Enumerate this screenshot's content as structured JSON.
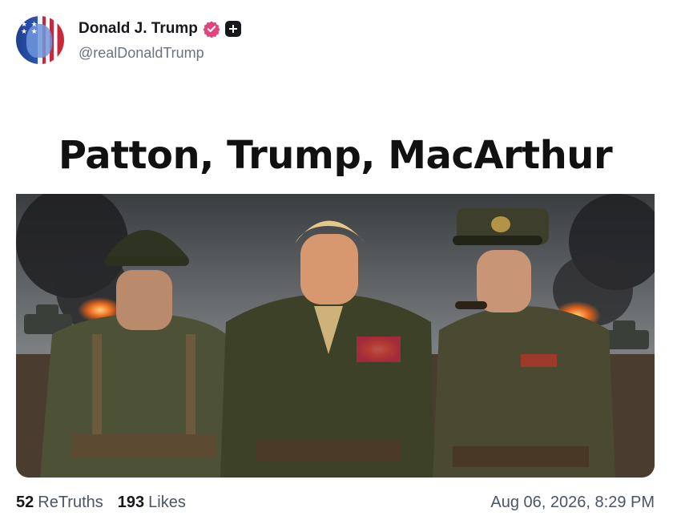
{
  "post": {
    "author": {
      "display_name": "Donald J. Trump",
      "handle": "@realDonaldTrump",
      "avatar_icon": "avatar-flag-portrait",
      "verified_icon": "verified-badge-icon",
      "plus_icon": "plus-square-icon"
    },
    "media": {
      "headline": "Patton, Trump, MacArthur",
      "image_description_icon": "military-portrait-image"
    },
    "stats": {
      "retruths_count": "52",
      "retruths_label": "ReTruths",
      "likes_count": "193",
      "likes_label": "Likes"
    },
    "timestamp": "Aug 06, 2026, 8:29 PM"
  },
  "colors": {
    "verified_pink": "#e0457b",
    "text_dark": "#16181c",
    "text_muted": "#6b7280"
  }
}
